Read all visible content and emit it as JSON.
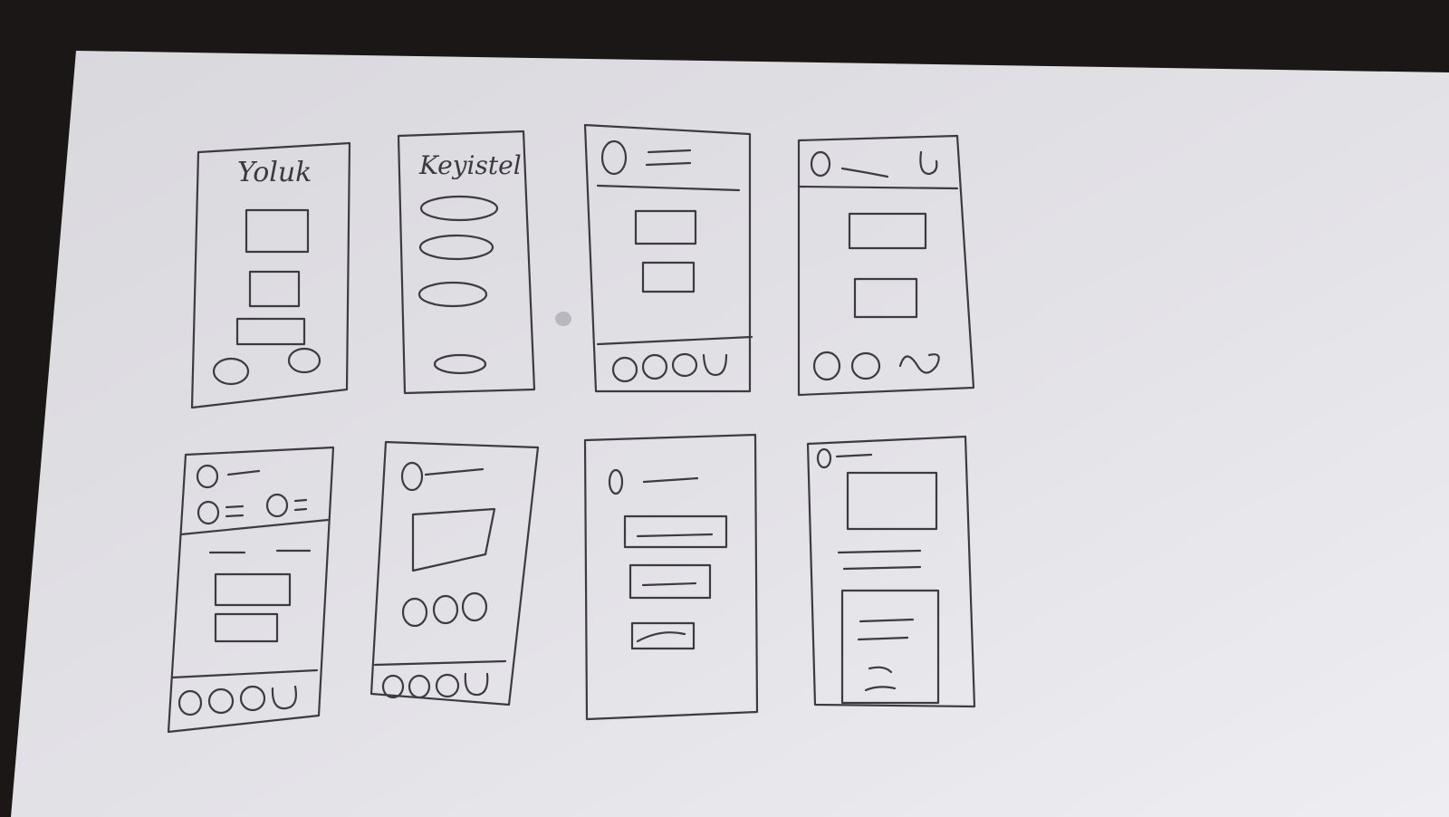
{
  "colors": {
    "table": "#1b1716",
    "paper": "#e4e3e8",
    "paper_shadow": "#cfcdd3",
    "pencil": "#3b3b40"
  },
  "sketches": [
    {
      "title": "Yoluk"
    },
    {
      "title": "Keyistel"
    },
    {
      "title": ""
    },
    {
      "title": ""
    },
    {
      "title": ""
    },
    {
      "title": ""
    },
    {
      "title": ""
    },
    {
      "title": ""
    }
  ]
}
